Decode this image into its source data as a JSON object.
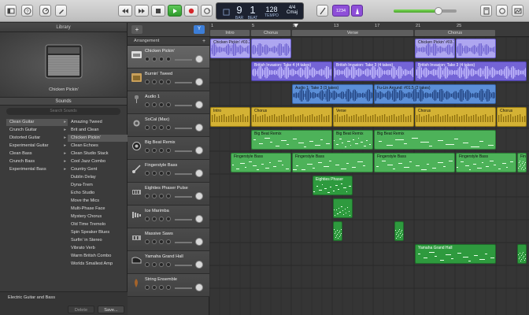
{
  "toolbar": {
    "lcd": {
      "bar": "9",
      "beat": "1",
      "bar_label": "BAR",
      "beat_label": "BEAT",
      "tempo": "128",
      "tempo_label": "TEMPO",
      "signature": "4/4",
      "key": "Cmaj"
    },
    "count_in_label": "1234",
    "master_volume": 0.72,
    "icons": [
      "library-icon",
      "help-icon",
      "smart-controls-icon",
      "editors-icon",
      "rewind-icon",
      "fast-forward-icon",
      "stop-icon",
      "play-icon",
      "record-icon",
      "cycle-icon",
      "tuner-icon",
      "count-in-icon",
      "metronome-icon",
      "notepad-icon",
      "loop-browser-icon",
      "media-browser-icon"
    ]
  },
  "library": {
    "title": "Library",
    "preset_name": "Chicken Pickin'",
    "sounds_header": "Sounds",
    "search_placeholder": "Search Sounds",
    "categories": [
      "Clean Guitar",
      "Crunch Guitar",
      "Distorted Guitar",
      "Experimental Guitar",
      "Clean Bass",
      "Crunch Bass",
      "Experimental Bass"
    ],
    "patches": [
      "Amazing Tweed",
      "Brit and Clean",
      "Chicken Pickin'",
      "Clean Echoes",
      "Clean Studio Stack",
      "Cool Jazz Combo",
      "Country Gent",
      "Dublin Delay",
      "Dyna-Trem",
      "Echo Studio",
      "Move the Mics",
      "Multi-Phase Face",
      "Mystery Chorus",
      "Old Time Tremolo",
      "Spin Speaker Blues",
      "Surfin' in Stereo",
      "Vibrato Verb",
      "Warm British Combo",
      "Worlds Smallest Amp"
    ],
    "footer_category": "Electric Guitar and Bass",
    "delete_label": "Delete",
    "save_label": "Save..."
  },
  "arrangement": {
    "header_label": "Arrangement",
    "add_label": "+",
    "filter_label": "Y",
    "sections": [
      "Intro",
      "Chorus",
      "Verse",
      "Chorus"
    ],
    "bar_numbers": [
      "1",
      "5",
      "9",
      "13",
      "17",
      "21",
      "25"
    ]
  },
  "tracks": [
    {
      "name": "Chicken Pickin'",
      "color": "#aea6f0"
    },
    {
      "name": "Burnin' Tweed",
      "color": "#7464d6"
    },
    {
      "name": "Audio 1",
      "color": "#5b8fd8"
    },
    {
      "name": "SoCal (Max)",
      "color": "#d4b234"
    },
    {
      "name": "Big Beat Remix",
      "color": "#4db259"
    },
    {
      "name": "Fingerstyle Bass",
      "color": "#4db259"
    },
    {
      "name": "Eighties Phaser Pulse",
      "color": "#2e9a3e"
    },
    {
      "name": "Ice Marimba",
      "color": "#2e9a3e"
    },
    {
      "name": "Massive Saws",
      "color": "#2e9a3e"
    },
    {
      "name": "Yamaha Grand Hall",
      "color": "#2e9a3e"
    },
    {
      "name": "String Ensemble",
      "color": "#2e9a3e"
    }
  ],
  "regions": {
    "t0": [
      "Chicken Pickin' #03.3",
      "Chicken Pickin' #03.12"
    ],
    "t1": [
      "British Invasion: Take 4 (4 takes)",
      "British Invasion: Take 3 (4 takes)",
      "British Invasion: Take 3 (4 takes)"
    ],
    "t2": [
      "Audio 1: Take 3 (3 takes)",
      "Fu-Lin Around: #01.5 (2 takes)"
    ],
    "t3": [
      "Intro",
      "Chorus",
      "Verse",
      "Chorus",
      "Chorus"
    ],
    "t4": [
      "Big Beat Remix",
      "Big Beat Remix",
      "Big Beat Remix"
    ],
    "t5": [
      "Fingerstyle Bass",
      "Fingerstyle Bass",
      "Fingerstyle Bass",
      "Fingerstyle Bass",
      "Fingerstyle Bass"
    ],
    "t6": [
      "Eighties Phaser"
    ],
    "t9": [
      "Yamaha Grand Hall"
    ]
  }
}
